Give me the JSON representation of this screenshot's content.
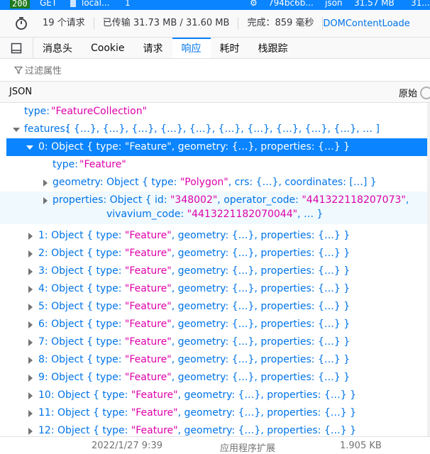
{
  "request_bar": {
    "status": "200",
    "method": "GET",
    "domain": "local...",
    "file": "1",
    "initiator": "794bc6b...",
    "type": "json",
    "size": "31.57 MB",
    "time": "31..."
  },
  "summary": {
    "requests": "19 个请求",
    "transferred": "已传输 31.73 MB / 31.60 MB",
    "finish": "完成：859 毫秒",
    "dom": "DOMContentLoade"
  },
  "tabs": [
    "消息头",
    "Cookie",
    "请求",
    "响应",
    "耗时",
    "栈跟踪"
  ],
  "active_tab": "响应",
  "filter": {
    "placeholder": "过滤属性"
  },
  "json_header": {
    "title": "JSON",
    "raw_label": "原始"
  },
  "tree": {
    "type_key": "type:",
    "type_val": "\"FeatureCollection\"",
    "features_key": "features:",
    "features_val": "[ {…}, {…}, {…}, {…}, {…}, {…}, {…}, {…}, {…}, {…}, … ]",
    "item0": "0: Object { type: \"Feature\", geometry: {…}, properties: {…} }",
    "item0_type_key": "type:",
    "item0_type_val": "\"Feature\"",
    "geometry_pre": "geometry: Object { type: ",
    "geometry_str": "\"Polygon\"",
    "geometry_post": ", crs: {…}, coordinates: […] }",
    "props_pre": "properties: Object { id: ",
    "props_id": "\"348002\"",
    "props_mid": ", operator_code: ",
    "props_op": "\"441322118207073\"",
    "props_comma": ",",
    "props_viv_key": "vivavium_code: ",
    "props_viv": "\"4413221182070044\"",
    "props_post": ", … }",
    "items": [
      {
        "label": "1: Object { type: ",
        "str": "\"Feature\"",
        "rest": ", geometry: {…}, properties: {…} }"
      },
      {
        "label": "2: Object { type: ",
        "str": "\"Feature\"",
        "rest": ", geometry: {…}, properties: {…} }"
      },
      {
        "label": "3: Object { type: ",
        "str": "\"Feature\"",
        "rest": ", geometry: {…}, properties: {…} }"
      },
      {
        "label": "4: Object { type: ",
        "str": "\"Feature\"",
        "rest": ", geometry: {…}, properties: {…} }"
      },
      {
        "label": "5: Object { type: ",
        "str": "\"Feature\"",
        "rest": ", geometry: {…}, properties: {…} }"
      },
      {
        "label": "6: Object { type: ",
        "str": "\"Feature\"",
        "rest": ", geometry: {…}, properties: {…} }"
      },
      {
        "label": "7: Object { type: ",
        "str": "\"Feature\"",
        "rest": ", geometry: {…}, properties: {…} }"
      },
      {
        "label": "8: Object { type: ",
        "str": "\"Feature\"",
        "rest": ", geometry: {…}, properties: {…} }"
      },
      {
        "label": "9: Object { type: ",
        "str": "\"Feature\"",
        "rest": ", geometry: {…}, properties: {…} }"
      },
      {
        "label": "10: Object { type: ",
        "str": "\"Feature\"",
        "rest": ", geometry: {…}, properties: {…} }"
      },
      {
        "label": "11: Object { type: ",
        "str": "\"Feature\"",
        "rest": ", geometry: {…}, properties: {…} }"
      },
      {
        "label": "12: Object { type: ",
        "str": "\"Feature\"",
        "rest": ", geometry: {…}, properties: {…} }"
      }
    ]
  },
  "bottom_row": {
    "date": "2022/1/27 9:39",
    "app": "应用程序扩展",
    "size": "1.905 KB"
  }
}
